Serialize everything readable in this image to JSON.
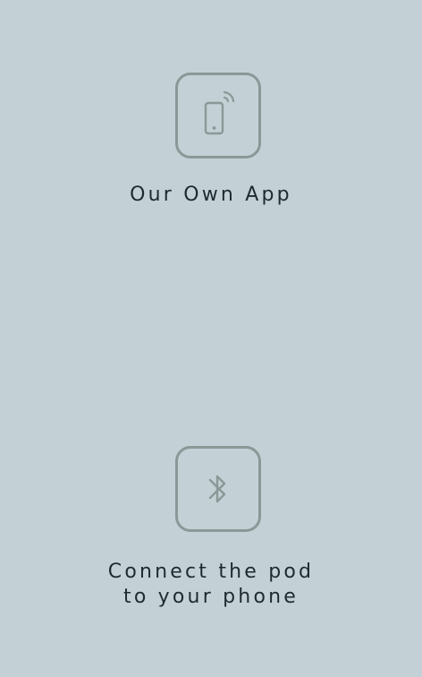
{
  "features": [
    {
      "icon": "smartphone-wifi-icon",
      "label_lines": [
        "Our Own App"
      ]
    },
    {
      "icon": "bluetooth-icon",
      "label_lines": [
        "Connect the pod",
        "to your phone"
      ]
    }
  ],
  "colors": {
    "background": "#c3d1d6",
    "icon_stroke": "#8a9897",
    "text": "#1f2a2e"
  }
}
